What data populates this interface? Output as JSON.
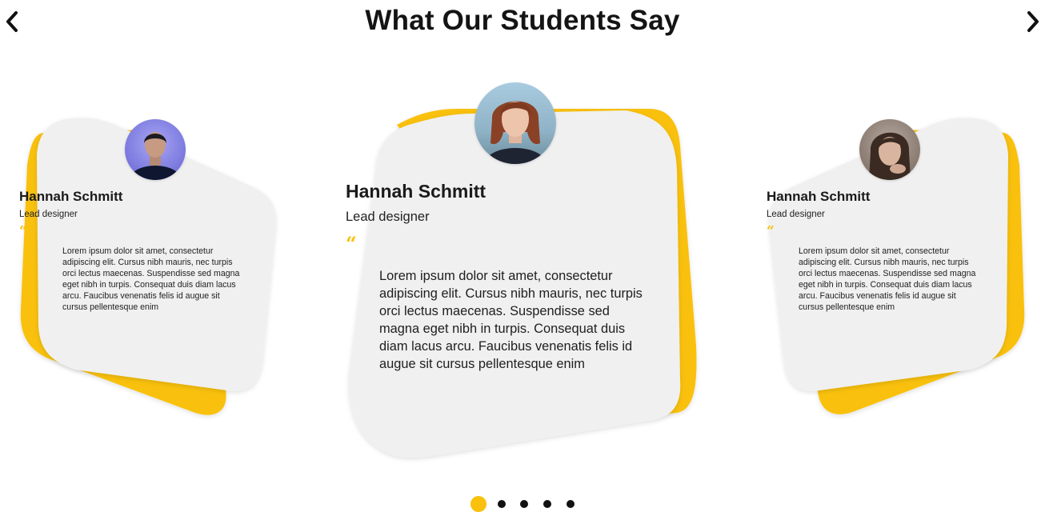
{
  "section": {
    "title": "What Our Students Say"
  },
  "navigation": {
    "prev_icon": "chevron-left-icon",
    "next_icon": "chevron-right-icon"
  },
  "colors": {
    "accent": "#f9c10c",
    "card": "#f0f0f0",
    "text": "#1c1c1c"
  },
  "testimonials": [
    {
      "name": "Hannah Schmitt",
      "role": "Lead designer",
      "quote_mark": "“",
      "text": "Lorem ipsum dolor sit amet, consectetur adipiscing elit. Cursus nibh mauris, nec turpis orci lectus maecenas. Suspendisse sed magna eget nibh in turpis. Consequat duis diam lacus arcu. Faucibus venenatis felis id augue sit cursus pellentesque enim"
    },
    {
      "name": "Hannah Schmitt",
      "role": "Lead designer",
      "quote_mark": "“",
      "text": "Lorem ipsum dolor sit amet, consectetur adipiscing elit. Cursus nibh mauris, nec turpis orci lectus maecenas. Suspendisse sed magna eget nibh in turpis. Consequat duis diam lacus arcu. Faucibus venenatis felis id augue sit cursus pellentesque enim"
    },
    {
      "name": "Hannah Schmitt",
      "role": "Lead designer",
      "quote_mark": "“",
      "text": "Lorem ipsum dolor sit amet, consectetur adipiscing elit. Cursus nibh mauris, nec turpis orci lectus maecenas. Suspendisse sed magna eget nibh in turpis. Consequat duis diam lacus arcu. Faucibus venenatis felis id augue sit cursus pellentesque enim"
    }
  ],
  "pagination": {
    "total": 5,
    "active_index": 0
  }
}
